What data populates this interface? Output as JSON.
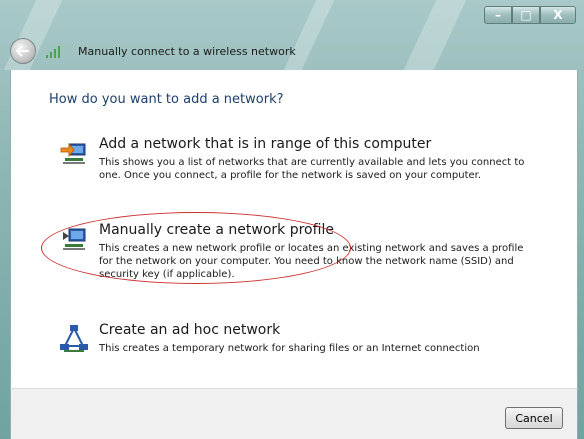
{
  "window": {
    "title": "Manually connect to a wireless network",
    "controls": {
      "minimize": "–",
      "maximize": "□",
      "close": "X"
    }
  },
  "main": {
    "question": "How do you want to add a network?",
    "options": [
      {
        "icon": "network-add-icon",
        "title": "Add a network that is in range of this computer",
        "description": "This shows you a list of networks that are currently available and lets you connect to one. Once you connect, a profile for the network is saved on your computer."
      },
      {
        "icon": "network-profile-icon",
        "title": "Manually create a network profile",
        "description": "This creates a new network profile or locates an existing network and saves a profile for the network on your computer. You need to know the network name (SSID) and security key (if applicable)."
      },
      {
        "icon": "adhoc-network-icon",
        "title": "Create an ad hoc network",
        "description": "This creates a temporary network for sharing files or an Internet connection"
      }
    ]
  },
  "footer": {
    "cancel_label": "Cancel"
  },
  "colors": {
    "question_text": "#1e3f6b",
    "highlight": "#cc3030",
    "frame": "#8fb7b5"
  }
}
